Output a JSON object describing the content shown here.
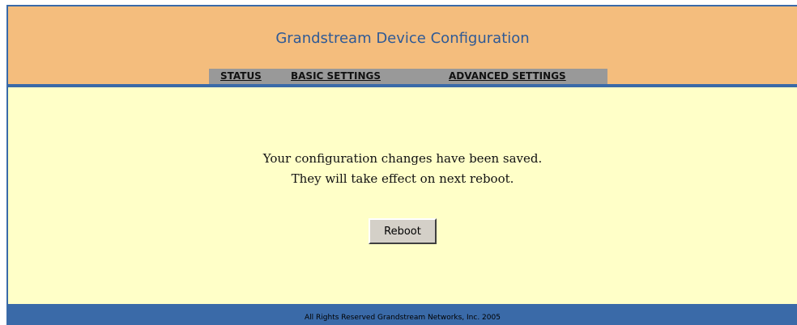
{
  "header": {
    "title": "Grandstream Device Configuration"
  },
  "nav": {
    "status": "STATUS",
    "basic_settings": "BASIC SETTINGS",
    "advanced_settings": "ADVANCED SETTINGS"
  },
  "main": {
    "message_line1": "Your configuration changes have been saved.",
    "message_line2": "They will take effect on next reboot.",
    "reboot_label": "Reboot"
  },
  "footer": {
    "copyright": "All Rights Reserved Grandstream Networks, Inc. 2005"
  },
  "colors": {
    "header_bg": "#f4bd7d",
    "accent_blue": "#3a6aa8",
    "content_bg": "#ffffc8",
    "nav_bar_bg": "#999999"
  }
}
